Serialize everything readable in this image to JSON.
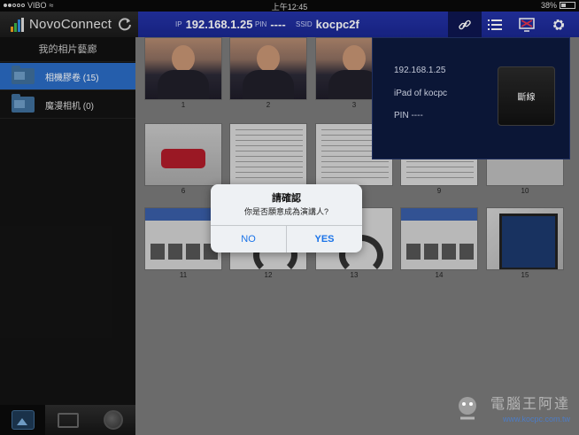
{
  "status_bar": {
    "carrier": "VIBO",
    "time": "上午12:45",
    "battery": "38%",
    "battery_level": 0.38
  },
  "header": {
    "app_name": "NovoConnect",
    "ip_label": "IP",
    "ip_value": "192.168.1.25",
    "pin_label": "PIN",
    "pin_value": "----",
    "ssid_label": "SSID",
    "ssid_value": "kocpc2f",
    "buttons": [
      "link-icon",
      "list-icon",
      "screen-icon",
      "gear-icon"
    ]
  },
  "sidebar": {
    "title": "我的相片藝廊",
    "items": [
      {
        "label": "相機膠卷 (15)",
        "active": true
      },
      {
        "label": "魔漫相机 (0)",
        "active": false
      }
    ],
    "bottom_tabs": [
      "photo-gallery-icon",
      "folder-icon",
      "web-icon"
    ]
  },
  "gallery": {
    "items": [
      {
        "num": "1",
        "kind": "photo"
      },
      {
        "num": "2",
        "kind": "photo"
      },
      {
        "num": "3",
        "kind": "photo"
      },
      {
        "num": "4",
        "kind": "shirt"
      },
      {
        "num": "5",
        "kind": "shirt"
      },
      {
        "num": "6",
        "kind": "device"
      },
      {
        "num": "7",
        "kind": "doc"
      },
      {
        "num": "8",
        "kind": "doc"
      },
      {
        "num": "9",
        "kind": "doc"
      },
      {
        "num": "10",
        "kind": "shirt"
      },
      {
        "num": "11",
        "kind": "web"
      },
      {
        "num": "12",
        "kind": "head"
      },
      {
        "num": "13",
        "kind": "head"
      },
      {
        "num": "14",
        "kind": "web"
      },
      {
        "num": "15",
        "kind": "tablet"
      }
    ]
  },
  "connection_popup": {
    "ip": "192.168.1.25",
    "device": "iPad of kocpc",
    "pin": "PIN ----",
    "disconnect_label": "斷線"
  },
  "dialog": {
    "title": "請確認",
    "message": "你是否願意成為演講人?",
    "no_label": "NO",
    "yes_label": "YES"
  },
  "watermark": {
    "url": "www.kocpc.com.tw"
  },
  "colors": {
    "header_blue": "#2433a8",
    "sidebar_active": "#2b6cc4",
    "dialog_button": "#1a73e8"
  }
}
